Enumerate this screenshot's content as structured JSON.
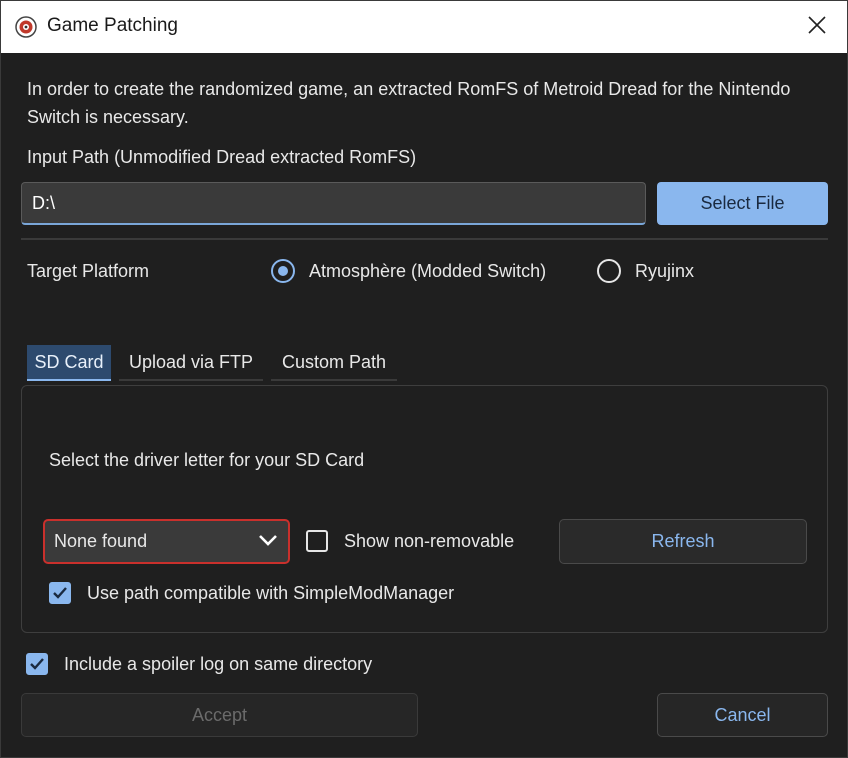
{
  "window": {
    "title": "Game Patching",
    "app_icon": "randovania-icon",
    "close_icon": "close-icon"
  },
  "main": {
    "description": "In order to create the randomized game, an extracted RomFS of Metroid Dread for the Nintendo Switch is necessary.",
    "input_label": "Input Path (Unmodified Dread extracted RomFS)",
    "input_value": "D:\\",
    "select_file_label": "Select File",
    "target_platform_label": "Target Platform",
    "platforms": [
      {
        "label": "Atmosphère (Modded Switch)",
        "selected": true
      },
      {
        "label": "Ryujinx",
        "selected": false
      }
    ],
    "tabs": [
      {
        "label": "SD Card",
        "active": true
      },
      {
        "label": "Upload via FTP",
        "active": false
      },
      {
        "label": "Custom Path",
        "active": false
      }
    ],
    "sd_card": {
      "instruction": "Select the driver letter for your SD Card",
      "drive_selected": "None found",
      "show_non_removable_label": "Show non-removable",
      "show_non_removable_checked": false,
      "refresh_label": "Refresh",
      "simple_mod_manager_label": "Use path compatible with SimpleModManager",
      "simple_mod_manager_checked": true
    },
    "spoiler_log_label": "Include a spoiler log on same directory",
    "spoiler_log_checked": true,
    "accept_label": "Accept",
    "cancel_label": "Cancel"
  },
  "colors": {
    "accent": "#8ab7ee",
    "background": "#1f1f1f",
    "error_border": "#c9302c"
  }
}
